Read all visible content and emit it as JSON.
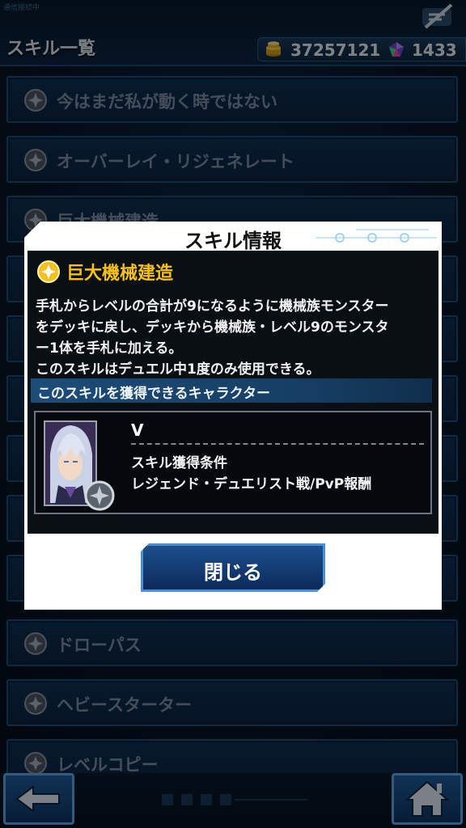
{
  "header": {
    "status_text": "通信接続中",
    "title": "スキル一覧",
    "gold": "37257121",
    "gems": "1433",
    "gold_icon": "gold-coins-icon",
    "gem_icon": "gem-icon",
    "menu_icon": "menu-icon"
  },
  "skill_list": {
    "items": [
      {
        "label": "今はまだ私が動く時ではない"
      },
      {
        "label": "オーバーレイ・リジェネレート"
      },
      {
        "label": "巨大機械建造"
      },
      {
        "label": ""
      },
      {
        "label": ""
      },
      {
        "label": ""
      },
      {
        "label": ""
      },
      {
        "label": ""
      },
      {
        "label": ""
      },
      {
        "label": "ドローパス"
      },
      {
        "label": "ヘビースターター"
      },
      {
        "label": "レベルコピー"
      }
    ]
  },
  "modal": {
    "title": "スキル情報",
    "skill_name": "巨大機械建造",
    "description": [
      "手札からレベルの合計が9になるように機械族モンスター",
      "をデッキに戻し、デッキから機械族・レベル9のモンスタ",
      "ー1体を手札に加える。",
      "このスキルはデュエル中1度のみ使用できる。"
    ],
    "obtain_header": "このスキルを獲得できるキャラクター",
    "character": {
      "name": "V",
      "condition_label": "スキル獲得条件",
      "condition_value": "レジェンド・デュエリスト戦/PvP報酬"
    },
    "close_label": "閉じる"
  },
  "footer": {
    "back_icon": "back-arrow-icon",
    "home_icon": "home-icon"
  },
  "colors": {
    "skill_name": "#f6c21a",
    "panel_bg": "#0a0f14",
    "button_border": "#4d8fd6"
  }
}
